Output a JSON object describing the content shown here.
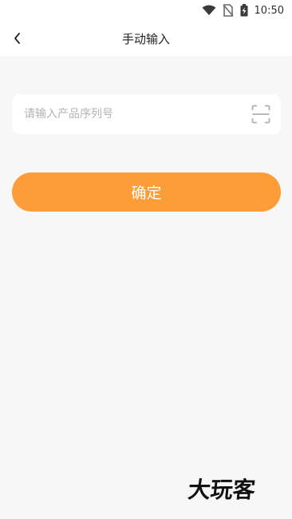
{
  "status_bar": {
    "time": "10:50",
    "icons": [
      "wifi-icon",
      "no-sim-icon",
      "battery-charging-icon"
    ]
  },
  "nav": {
    "title": "手动输入",
    "back_icon": "chevron-left-icon"
  },
  "serial_input": {
    "placeholder": "请输入产品序列号",
    "value": "",
    "scan_icon": "scan-frame-icon"
  },
  "confirm_button": {
    "label": "确定"
  },
  "watermark": {
    "text": "大玩客"
  },
  "colors": {
    "accent": "#fd9d37",
    "background": "#f7f7f7",
    "card": "#ffffff"
  }
}
